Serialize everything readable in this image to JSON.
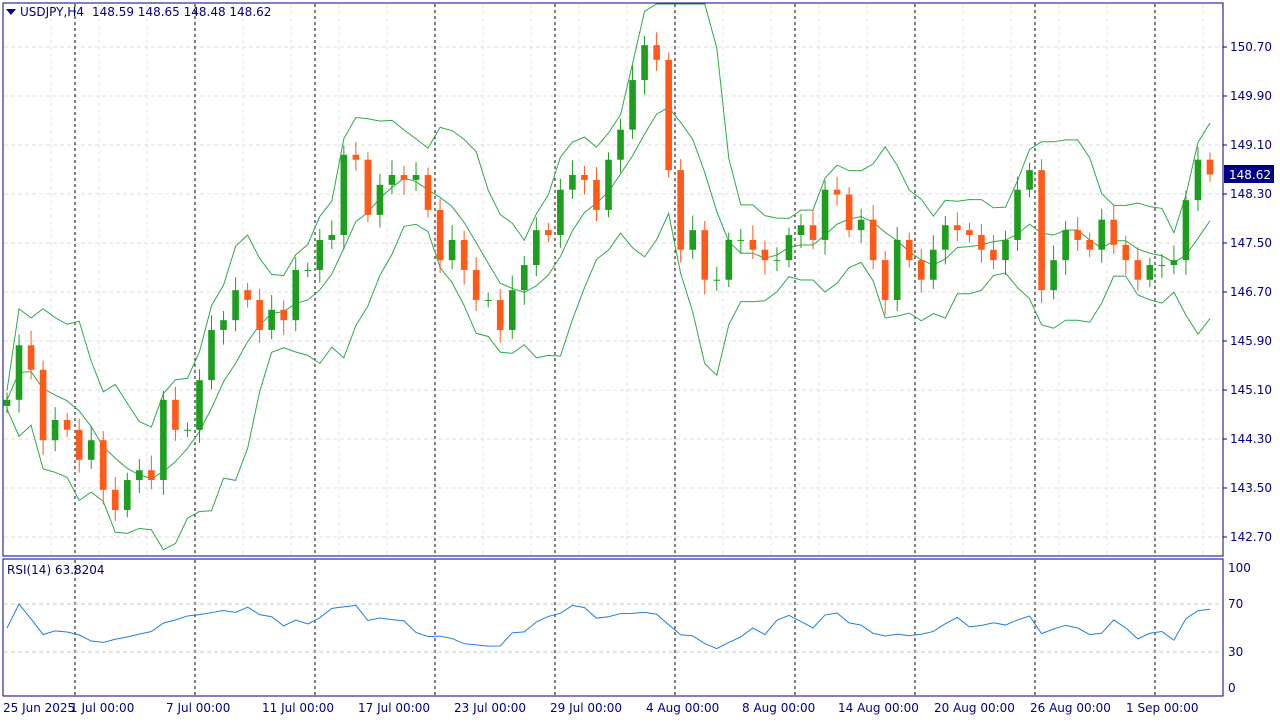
{
  "header": {
    "symbol": "USDJPY,H4",
    "ohlc": "148.59 148.65 148.48 148.62"
  },
  "rsi_panel": {
    "label": "RSI(14) 63.8204",
    "levels": [
      "100",
      "70",
      "30",
      "0"
    ]
  },
  "current_price": "148.62",
  "colors": {
    "bull": "#1e9e1e",
    "bear": "#ff5a1a",
    "bands": "#2ea84a",
    "rsi": "#1e7fe0",
    "axis": "#000080"
  },
  "chart_data": {
    "type": "candlestick",
    "title": "USDJPY,H4",
    "ylim": [
      142.5,
      151.3
    ],
    "y_ticks": [
      "150.70",
      "149.90",
      "149.10",
      "148.30",
      "147.50",
      "146.70",
      "145.90",
      "145.10",
      "144.30",
      "143.50",
      "142.70"
    ],
    "x_ticks": [
      "25 Jun 2025",
      "1 Jul 00:00",
      "7 Jul 00:00",
      "11 Jul 00:00",
      "17 Jul 00:00",
      "23 Jul 00:00",
      "29 Jul 00:00",
      "4 Aug 00:00",
      "8 Aug 00:00",
      "14 Aug 00:00",
      "20 Aug 00:00",
      "26 Aug 00:00",
      "1 Sep 00:00"
    ],
    "closes": [
      144.94,
      145.83,
      145.43,
      144.28,
      144.61,
      144.45,
      143.96,
      144.28,
      143.47,
      143.14,
      143.63,
      143.79,
      143.63,
      144.94,
      144.45,
      144.45,
      145.26,
      146.08,
      146.24,
      146.73,
      146.57,
      146.08,
      146.41,
      146.24,
      147.06,
      147.06,
      147.55,
      147.63,
      148.94,
      148.86,
      147.96,
      148.45,
      148.61,
      148.53,
      148.61,
      148.04,
      147.22,
      147.55,
      147.06,
      146.57,
      146.57,
      146.08,
      146.73,
      147.14,
      147.71,
      147.63,
      148.37,
      148.61,
      148.53,
      148.04,
      148.86,
      149.35,
      150.16,
      150.73,
      150.49,
      148.69,
      147.39,
      147.71,
      146.9,
      146.9,
      147.55,
      147.55,
      147.39,
      147.22,
      147.22,
      147.63,
      147.79,
      147.55,
      148.37,
      148.29,
      147.71,
      147.88,
      147.22,
      146.57,
      147.55,
      147.22,
      146.9,
      147.39,
      147.79,
      147.71,
      147.63,
      147.39,
      147.22,
      147.55,
      148.37,
      148.69,
      146.73,
      147.22,
      147.71,
      147.55,
      147.39,
      147.88,
      147.47,
      147.22,
      146.9,
      147.14,
      147.14,
      147.22,
      148.2,
      148.86,
      148.62
    ],
    "indicators": [
      "Bollinger Bands",
      "RSI(14)"
    ],
    "rsi_ylim": [
      0,
      100
    ]
  }
}
